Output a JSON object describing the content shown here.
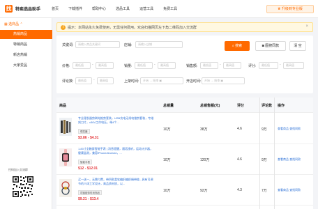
{
  "app": {
    "logo_char": "找",
    "brand": "特卖选品助手"
  },
  "nav": [
    "首页",
    "下载插件",
    "帮助中心",
    "选品工具",
    "运营工具",
    "免费工具"
  ],
  "upgrade_label": "升级到专业版",
  "sidebar": {
    "section": "选商品",
    "items": [
      {
        "label": "热销商品",
        "active": true
      },
      {
        "label": "特销商品",
        "active": false
      },
      {
        "label": "新店热销",
        "active": false
      },
      {
        "label": "大家爱品",
        "active": false
      }
    ],
    "qr_label": "扫码加入交流群"
  },
  "notice": {
    "icon": "!",
    "text": "提示：本网站永久免费使用，无需任何费用。欢迎扫描网页左下角二维码加入交流群",
    "close": "×"
  },
  "filters": {
    "keyword_label": "关键词:",
    "keyword_placeholder": "请输入商品关键词",
    "shop_label": "店铺:",
    "shop_placeholder": "请输入店铺",
    "search_label": "搜索",
    "image_search_label": "图搜同款",
    "clear_label": "清 空",
    "price_label": "价格:",
    "sales_label": "销量:",
    "sales_amount_label": "销售额:",
    "rating_label": "评分:",
    "reviews_label": "评论数:",
    "listed_label": "上架时间:",
    "shop_open_label": "开店时间:",
    "min_placeholder": "最低值",
    "max_placeholder": "最高值",
    "start_placeholder": "开始",
    "end_placeholder": "结束",
    "range_dash": "-",
    "date_sep": "→"
  },
  "table": {
    "headers": [
      "商品",
      "总销量",
      "总销售额(元)",
      "评分",
      "评论数",
      "操作"
    ],
    "rows": [
      {
        "title": "专业理发器剪刷电推剪套装，USB充电无线电推剪套装，专维刻刀片，x36V工作电压，带4个...",
        "tag": "理发器",
        "price": "$3.86 - $4.31",
        "sales": "10万",
        "amount": "38万",
        "rating": "4.6",
        "reviews": "9万",
        "ops": "查看商品  查找同款"
      },
      {
        "title": "1.83寸全触屏智能手表 | 消息提醒，通话接听，运动计步器，健康监测，兼容iPhone/Android，...",
        "tag": "智能手表",
        "price": "$12 - $12.01",
        "sales": "10万",
        "amount": "120万",
        "rating": "4.6",
        "reviews": "9万",
        "ops": "查看商品  查找同款"
      },
      {
        "title": "买一送一，无需付费，带四款柔软编织编织绳带链 - 具有可调节的人体工学设计，高品质材质，以...",
        "tag": "项链链饰时尚饰品",
        "price": "$9.21 - $13.4",
        "sales": "10万",
        "amount": "92万",
        "rating": "4.3",
        "reviews": "7万",
        "ops": "查看商品  查找同款"
      }
    ]
  },
  "colors": {
    "accent": "#ff6a00",
    "link": "#2a6fd6",
    "price": "#e4393c"
  }
}
